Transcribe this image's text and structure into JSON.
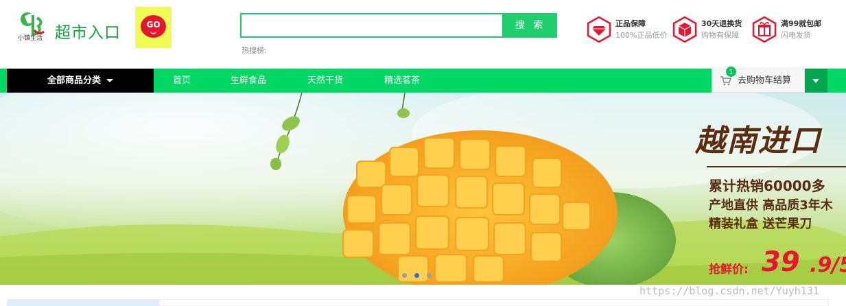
{
  "header": {
    "logo_text": "超市入口",
    "logo_subtext": "小镇生活",
    "go_badge": "GO",
    "search": {
      "value": "",
      "placeholder": "",
      "button": "搜 索"
    },
    "hot_label": "热搜榜:",
    "promises": [
      {
        "icon": "diamond-icon",
        "title": "正品保障",
        "desc": "100%正品低价"
      },
      {
        "icon": "box-icon",
        "title": "30天退换货",
        "desc": "购物有保障"
      },
      {
        "icon": "gift-icon",
        "title": "满99就包邮",
        "desc": "闪电发货"
      }
    ]
  },
  "nav": {
    "category_button": "全部商品分类",
    "links": [
      "首页",
      "生鲜食品",
      "天然干货",
      "精选茗茶"
    ],
    "cart_label": "去购物车结算",
    "cart_count": "1"
  },
  "banner": {
    "headline": "越南进口",
    "line1": "累计热销60000多",
    "line2": "产地直供 高品质3年木",
    "line3": "精装礼盒 送芒果刀",
    "price_label": "抢鲜价:",
    "price_int": "39",
    "price_rest": ".9/5",
    "slide_count": 3,
    "active_slide": 2
  },
  "watermark": "https://blog.csdn.net/Yuyh131",
  "colors": {
    "brand_green": "#00d765",
    "search_green": "#1fce6d",
    "nav_black": "#000000",
    "price_red": "#e8152f",
    "banner_text": "#5a2d11",
    "go_yellow": "#f1fb56"
  }
}
